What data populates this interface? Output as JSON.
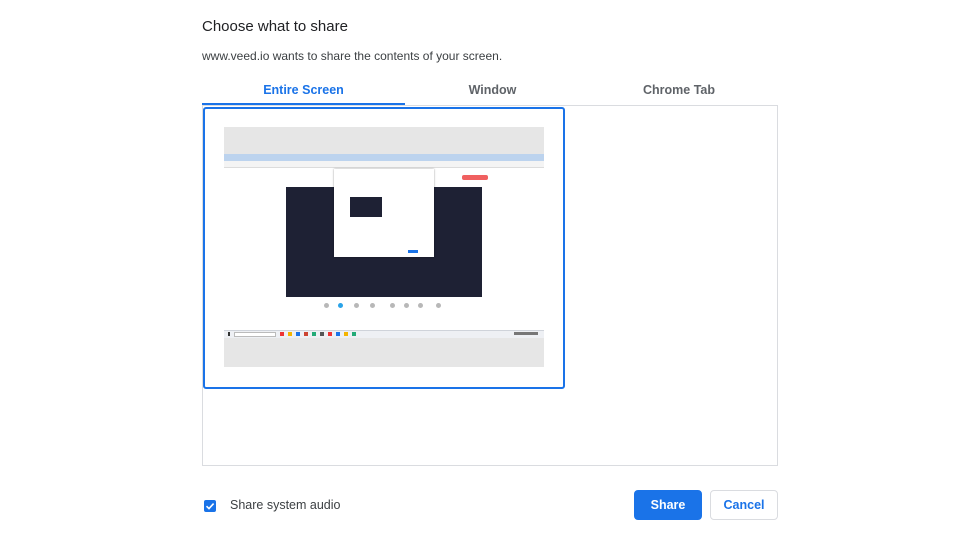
{
  "dialog": {
    "title": "Choose what to share",
    "subtitle": "www.veed.io wants to share the contents of your screen."
  },
  "tabs": [
    {
      "label": "Entire Screen",
      "selected": true
    },
    {
      "label": "Window",
      "selected": false
    },
    {
      "label": "Chrome Tab",
      "selected": false
    }
  ],
  "audio": {
    "label": "Share system audio",
    "checked": true
  },
  "buttons": {
    "share": "Share",
    "cancel": "Cancel"
  },
  "colors": {
    "accent": "#1a73e8",
    "border": "#dadce0",
    "text": "#202124"
  }
}
